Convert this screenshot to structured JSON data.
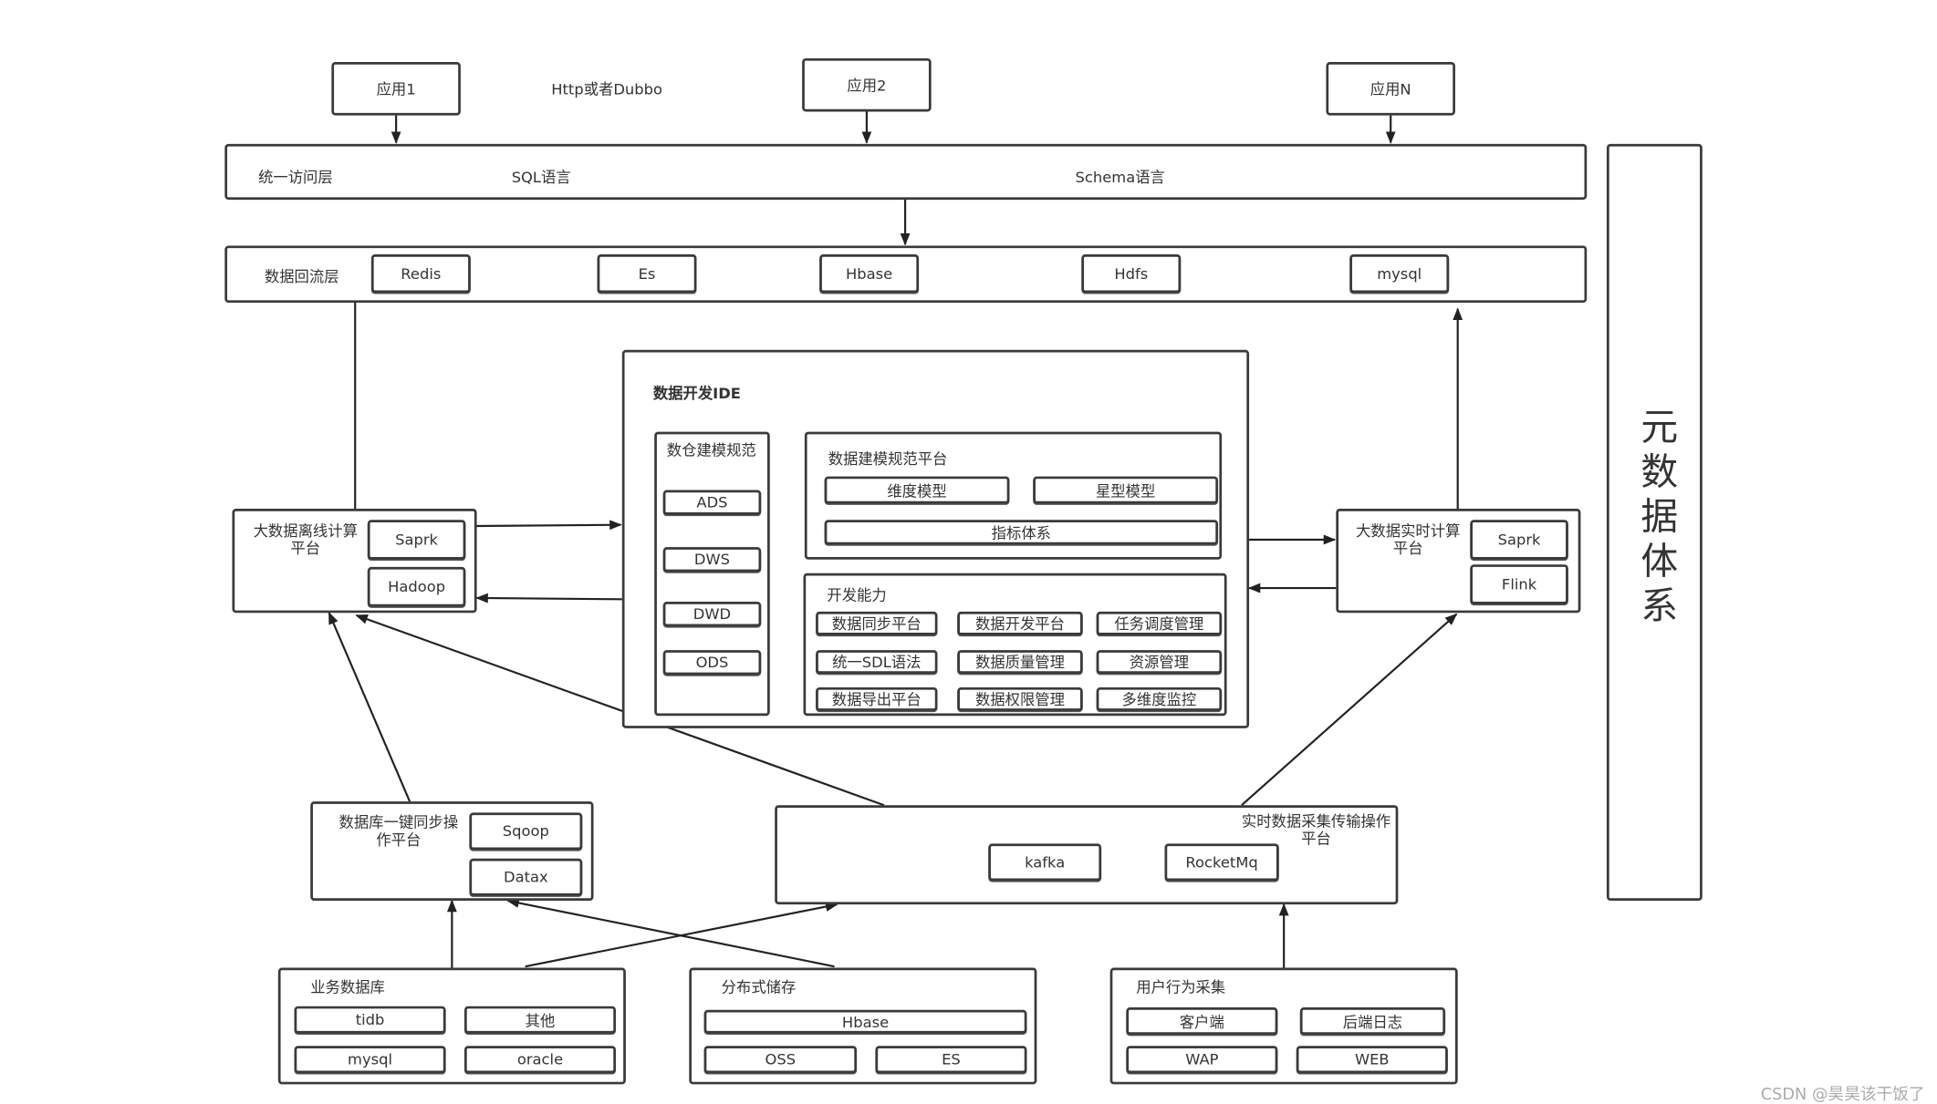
{
  "apps": [
    "应用1",
    "应用2",
    "应用N"
  ],
  "protocol": "Http或者Dubbo",
  "access_layer": {
    "label": "统一访问层",
    "sql": "SQL语言",
    "schema": "Schema语言"
  },
  "backflow_layer": {
    "label": "数据回流层",
    "items": [
      "Redis",
      "Es",
      "Hbase",
      "Hdfs",
      "mysql"
    ]
  },
  "metadata": "元数据体系",
  "ide": {
    "title": "数据开发IDE",
    "warehouse": {
      "title": "数仓建模规范",
      "layers": [
        "ADS",
        "DWS",
        "DWD",
        "ODS"
      ]
    },
    "modeling": {
      "title": "数据建模规范平台",
      "items": [
        "维度模型",
        "星型模型",
        "指标体系"
      ]
    },
    "dev": {
      "title": "开发能力",
      "items": [
        "数据同步平台",
        "数据开发平台",
        "任务调度管理",
        "统一SDL语法",
        "数据质量管理",
        "资源管理",
        "数据导出平台",
        "数据权限管理",
        "多维度监控"
      ]
    }
  },
  "offline": {
    "title": "大数据离线计算平台",
    "items": [
      "Saprk",
      "Hadoop"
    ]
  },
  "realtime": {
    "title": "大数据实时计算平台",
    "items": [
      "Saprk",
      "Flink"
    ]
  },
  "dbsync": {
    "title": "数据库一键同步操作平台",
    "items": [
      "Sqoop",
      "Datax"
    ]
  },
  "collect": {
    "title": "实时数据采集传输操作平台",
    "items": [
      "kafka",
      "RocketMq"
    ]
  },
  "bizdb": {
    "title": "业务数据库",
    "items": [
      "tidb",
      "其他",
      "mysql",
      "oracle"
    ]
  },
  "storage": {
    "title": "分布式储存",
    "items": [
      "Hbase",
      "OSS",
      "ES"
    ]
  },
  "behavior": {
    "title": "用户行为采集",
    "items": [
      "客户端",
      "后端日志",
      "WAP",
      "WEB"
    ]
  },
  "watermark": "CSDN @昊昊该干饭了"
}
